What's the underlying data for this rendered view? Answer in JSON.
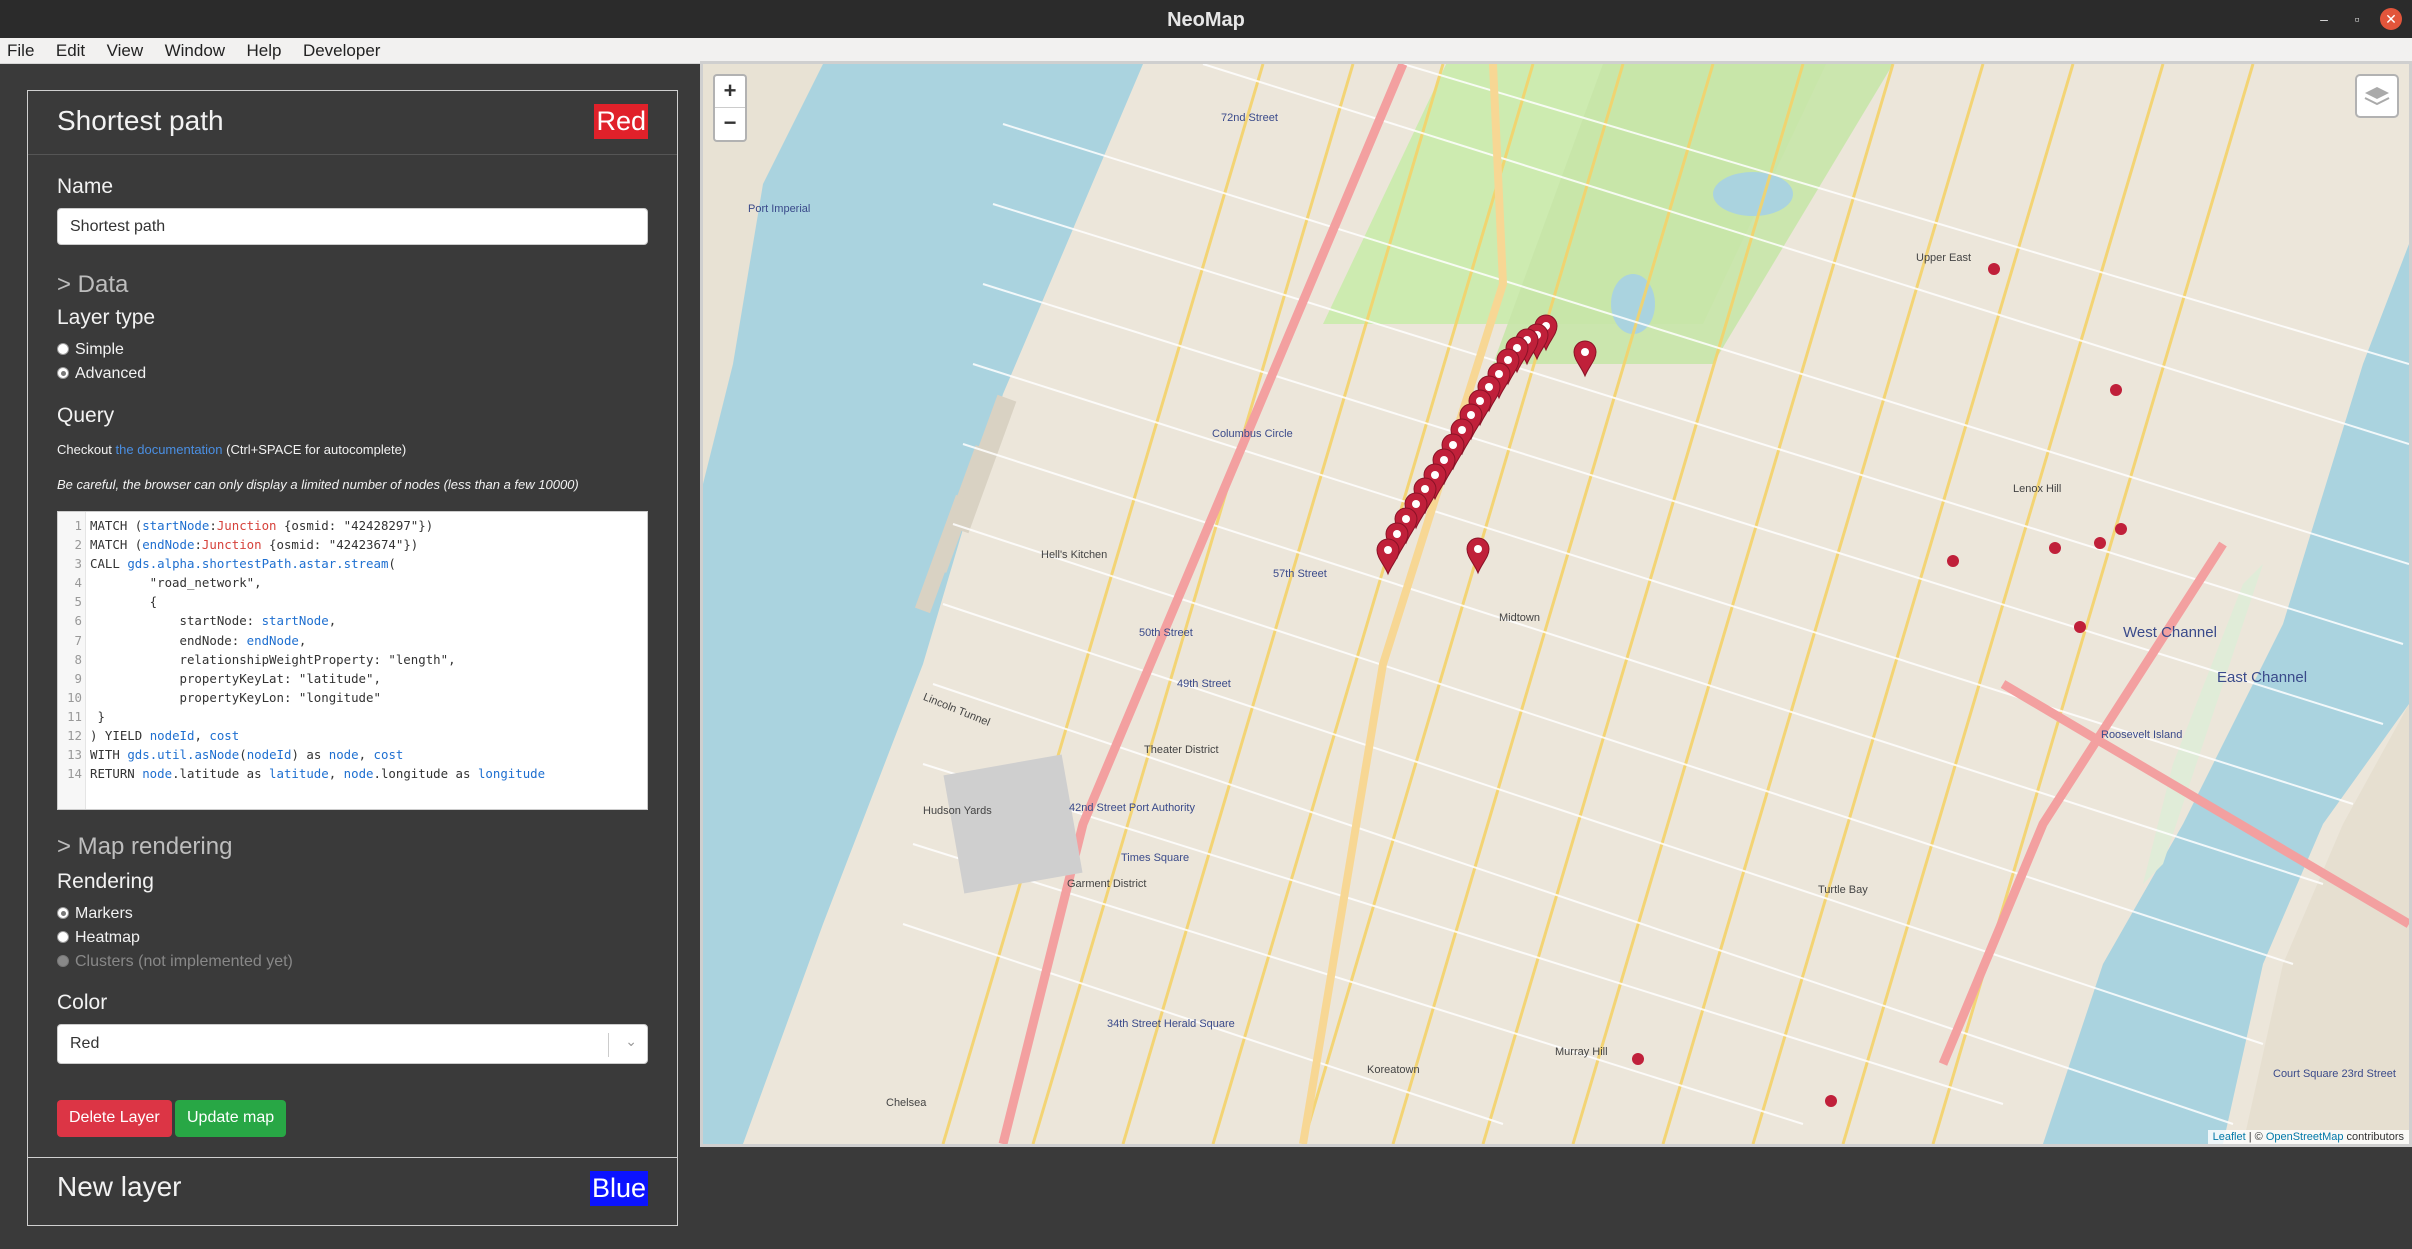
{
  "window": {
    "title": "NeoMap",
    "minimize": "–",
    "restore": "▫",
    "close": "✕"
  },
  "menu": [
    "File",
    "Edit",
    "View",
    "Window",
    "Help",
    "Developer"
  ],
  "layer1": {
    "title": "Shortest path",
    "badge": "Red",
    "badge_color": "#e0212a",
    "name_label": "Name",
    "name_value": "Shortest path",
    "data_section": "> Data",
    "layer_type_label": "Layer type",
    "layer_types": [
      "Simple",
      "Advanced"
    ],
    "layer_type_selected": "Advanced",
    "query_label": "Query",
    "help_prefix": "Checkout ",
    "help_link": "the documentation",
    "help_suffix": " (Ctrl+SPACE for autocomplete)",
    "warning": "Be careful, the browser can only display a limited number of nodes (less than a few 10000)",
    "query_lines": [
      [
        [
          "k",
          "MATCH ("
        ],
        [
          "v",
          "startNode"
        ],
        [
          "k",
          ":"
        ],
        [
          "t",
          "Junction"
        ],
        [
          "k",
          " {osmid: \"42428297\"})"
        ]
      ],
      [
        [
          "k",
          "MATCH ("
        ],
        [
          "v",
          "endNode"
        ],
        [
          "k",
          ":"
        ],
        [
          "t",
          "Junction"
        ],
        [
          "k",
          " {osmid: \"42423674\"})"
        ]
      ],
      [
        [
          "k",
          "CALL "
        ],
        [
          "v",
          "gds.alpha.shortestPath.astar.stream"
        ],
        [
          "k",
          "("
        ]
      ],
      [
        [
          "k",
          "        \"road_network\","
        ]
      ],
      [
        [
          "k",
          "        {"
        ]
      ],
      [
        [
          "k",
          "            startNode: "
        ],
        [
          "v",
          "startNode"
        ],
        [
          "k",
          ","
        ]
      ],
      [
        [
          "k",
          "            endNode: "
        ],
        [
          "v",
          "endNode"
        ],
        [
          "k",
          ","
        ]
      ],
      [
        [
          "k",
          "            relationshipWeightProperty: \"length\","
        ]
      ],
      [
        [
          "k",
          "            propertyKeyLat: \"latitude\","
        ]
      ],
      [
        [
          "k",
          "            propertyKeyLon: \"longitude\""
        ]
      ],
      [
        [
          "k",
          " }"
        ]
      ],
      [
        [
          "k",
          ") YIELD "
        ],
        [
          "v",
          "nodeId"
        ],
        [
          "k",
          ", "
        ],
        [
          "v",
          "cost"
        ]
      ],
      [
        [
          "k",
          "WITH "
        ],
        [
          "v",
          "gds.util.asNode"
        ],
        [
          "k",
          "("
        ],
        [
          "v",
          "nodeId"
        ],
        [
          "k",
          ") as "
        ],
        [
          "v",
          "node"
        ],
        [
          "k",
          ", "
        ],
        [
          "v",
          "cost"
        ]
      ],
      [
        [
          "k",
          "RETURN "
        ],
        [
          "v",
          "node"
        ],
        [
          "k",
          ".latitude as "
        ],
        [
          "v",
          "latitude"
        ],
        [
          "k",
          ", "
        ],
        [
          "v",
          "node"
        ],
        [
          "k",
          ".longitude as "
        ],
        [
          "v",
          "longitude"
        ]
      ]
    ],
    "map_rendering_section": "> Map rendering",
    "rendering_label": "Rendering",
    "rendering_options": [
      "Markers",
      "Heatmap",
      "Clusters (not implemented yet)"
    ],
    "rendering_selected": "Markers",
    "color_label": "Color",
    "color_value": "Red",
    "delete_button": "Delete Layer",
    "update_button": "Update map"
  },
  "layer2": {
    "title": "New layer",
    "badge": "Blue",
    "badge_color": "#0b13ff"
  },
  "map": {
    "zoom_in": "+",
    "zoom_out": "−",
    "attribution_link1": "Leaflet",
    "attribution_sep": " | © ",
    "attribution_link2": "OpenStreetMap",
    "attribution_suffix": " contributors",
    "marker_color": "#c0203a",
    "labels": [
      {
        "text": "72nd Street",
        "cls": ""
      },
      {
        "text": "Columbus Circle",
        "cls": ""
      },
      {
        "text": "57th Street",
        "cls": ""
      },
      {
        "text": "50th Street",
        "cls": ""
      },
      {
        "text": "49th Street",
        "cls": ""
      },
      {
        "text": "42nd Street Port Authority",
        "cls": ""
      },
      {
        "text": "Times Square",
        "cls": ""
      },
      {
        "text": "Lincoln Tunnel",
        "cls": "dark"
      },
      {
        "text": "Hudson Yards",
        "cls": "dark"
      },
      {
        "text": "Hell's Kitchen",
        "cls": "dark"
      },
      {
        "text": "Theater District",
        "cls": "dark"
      },
      {
        "text": "Garment District",
        "cls": "dark"
      },
      {
        "text": "Midtown",
        "cls": "dark"
      },
      {
        "text": "Lenox Hill",
        "cls": "dark"
      },
      {
        "text": "Upper East",
        "cls": "dark"
      },
      {
        "text": "Roosevelt Island",
        "cls": ""
      },
      {
        "text": "East Channel",
        "cls": ""
      },
      {
        "text": "West Channel",
        "cls": ""
      },
      {
        "text": "Port Imperial",
        "cls": ""
      },
      {
        "text": "Murray Hill",
        "cls": "dark"
      },
      {
        "text": "Turtle Bay",
        "cls": "dark"
      },
      {
        "text": "Chelsea",
        "cls": "dark"
      },
      {
        "text": "Koreatown",
        "cls": "dark"
      },
      {
        "text": "34th Street Herald Square",
        "cls": ""
      },
      {
        "text": "Court Square 23rd Street",
        "cls": ""
      }
    ]
  }
}
